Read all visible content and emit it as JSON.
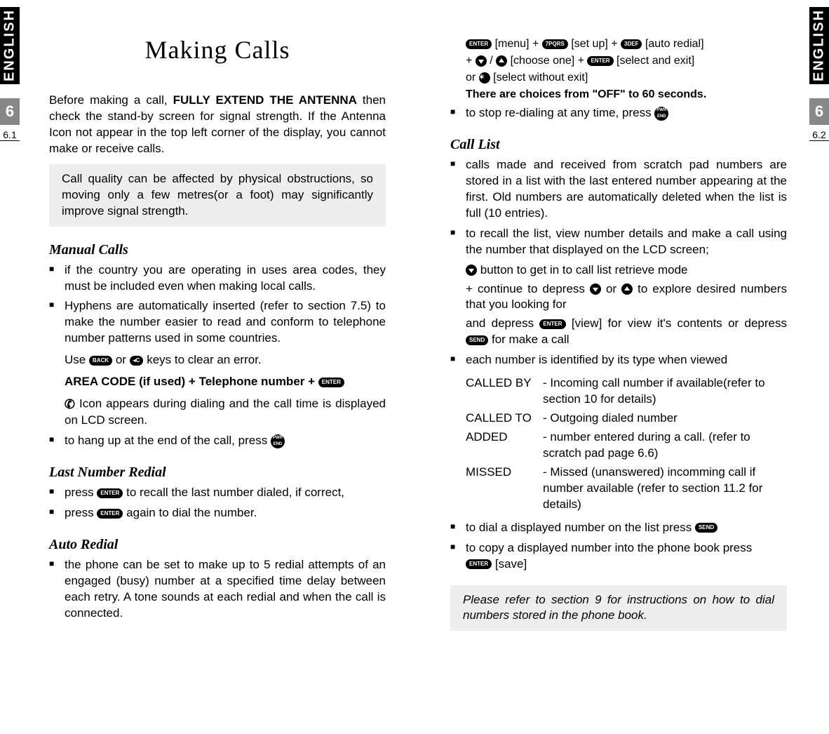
{
  "tabs": {
    "left": "ENGLISH",
    "right": "ENGLISH"
  },
  "pagenums": {
    "left_big": "6",
    "left_sub": "6.1",
    "right_big": "6",
    "right_sub": "6.2"
  },
  "title": "Making Calls",
  "intro_pre": "Before making a call, ",
  "intro_bold": "FULLY EXTEND THE ANTENNA",
  "intro_post": " then check the stand-by screen for signal strength. If the Antenna Icon not appear in the top left corner of the display, you cannot make or receive calls.",
  "callout1": "Call quality can be affected by physical obstructions, so moving only a few metres(or a foot) may significantly improve signal strength.",
  "sec1": {
    "h": "Manual Calls",
    "b1": " if the country you are operating in uses area codes, they must be included even when making local calls.",
    "b2": " Hyphens are automatically inserted (refer to section 7.5) to make the number easier to read and conform to telephone number patterns used in some countries.",
    "use_pre": "Use ",
    "use_or": " or ",
    "use_post": " keys to clear an error.",
    "area_code": "AREA CODE (if used) + Telephone number + ",
    "icon_line": " Icon appears during dialing and the call time is displayed on LCD screen.",
    "b3_pre": " to hang up at the end of the call, press "
  },
  "sec2": {
    "h": "Last Number Redial",
    "b1_pre": "press ",
    "b1_post": " to recall the last number dialed, if correct,",
    "b2_pre": "press ",
    "b2_post": " again to dial the number."
  },
  "sec3": {
    "h": "Auto Redial",
    "b1": "the phone can be set to make up to 5 redial attempts of an engaged (busy) number at a specified time delay between each retry. A tone sounds at each redial and when the call is connected."
  },
  "right_top": {
    "menu": " [menu] + ",
    "setup": " [set up] + ",
    "autoredial": " [auto redial]",
    "plus": "+ ",
    "slash": " / ",
    "choose": " [choose one] + ",
    "select_exit": " [select and exit]",
    "or": "or ",
    "select_no_exit": " [select without exit]",
    "choices": "There are choices from \"OFF\" to 60 seconds.",
    "stop_pre": "to stop re-dialing at any time, press "
  },
  "sec4": {
    "h": "Call List",
    "b1": "calls made and received from scratch pad numbers are stored in a list with the last entered number appearing at the first. Old numbers are automatically deleted when the list is full (10 entries).",
    "b2": "to recall the list, view number details and make a call using the number that displayed on the LCD screen;",
    "b2a_post": " button to get in to call list retrieve mode",
    "b2b_pre": "+ continue to depress ",
    "b2b_mid": " or ",
    "b2b_post": " to explore desired numbers that you looking for",
    "b2c_pre": "and depress  ",
    "b2c_mid": " [view] for view it's contents or depress ",
    "b2c_post": " for make a call",
    "b3": " each number is identified by its type when viewed",
    "defs": [
      {
        "term": "CALLED BY",
        "def": "- Incoming call number if available(refer to section 10 for details)"
      },
      {
        "term": "CALLED TO",
        "def": "- Outgoing dialed number"
      },
      {
        "term": "ADDED",
        "def": "- number entered during a call. (refer to scratch pad page 6.6)"
      },
      {
        "term": "MISSED",
        "def": "- Missed (unanswered) incomming call if number available (refer to section 11.2 for details)"
      }
    ],
    "b4_pre": "to dial a displayed number on the list press ",
    "b5_pre": "to copy a displayed number into the phone book press",
    "b5_post": " [save]"
  },
  "callout2": "Please refer to section 9 for instructions on how to dial numbers stored in the phone book.",
  "btns": {
    "enter": "ENTER",
    "back": "BACK",
    "clr": "◂C",
    "pwr": "PWR\\nEND",
    "send": "SEND",
    "seven": "7PQRS",
    "three": "3DEF"
  }
}
